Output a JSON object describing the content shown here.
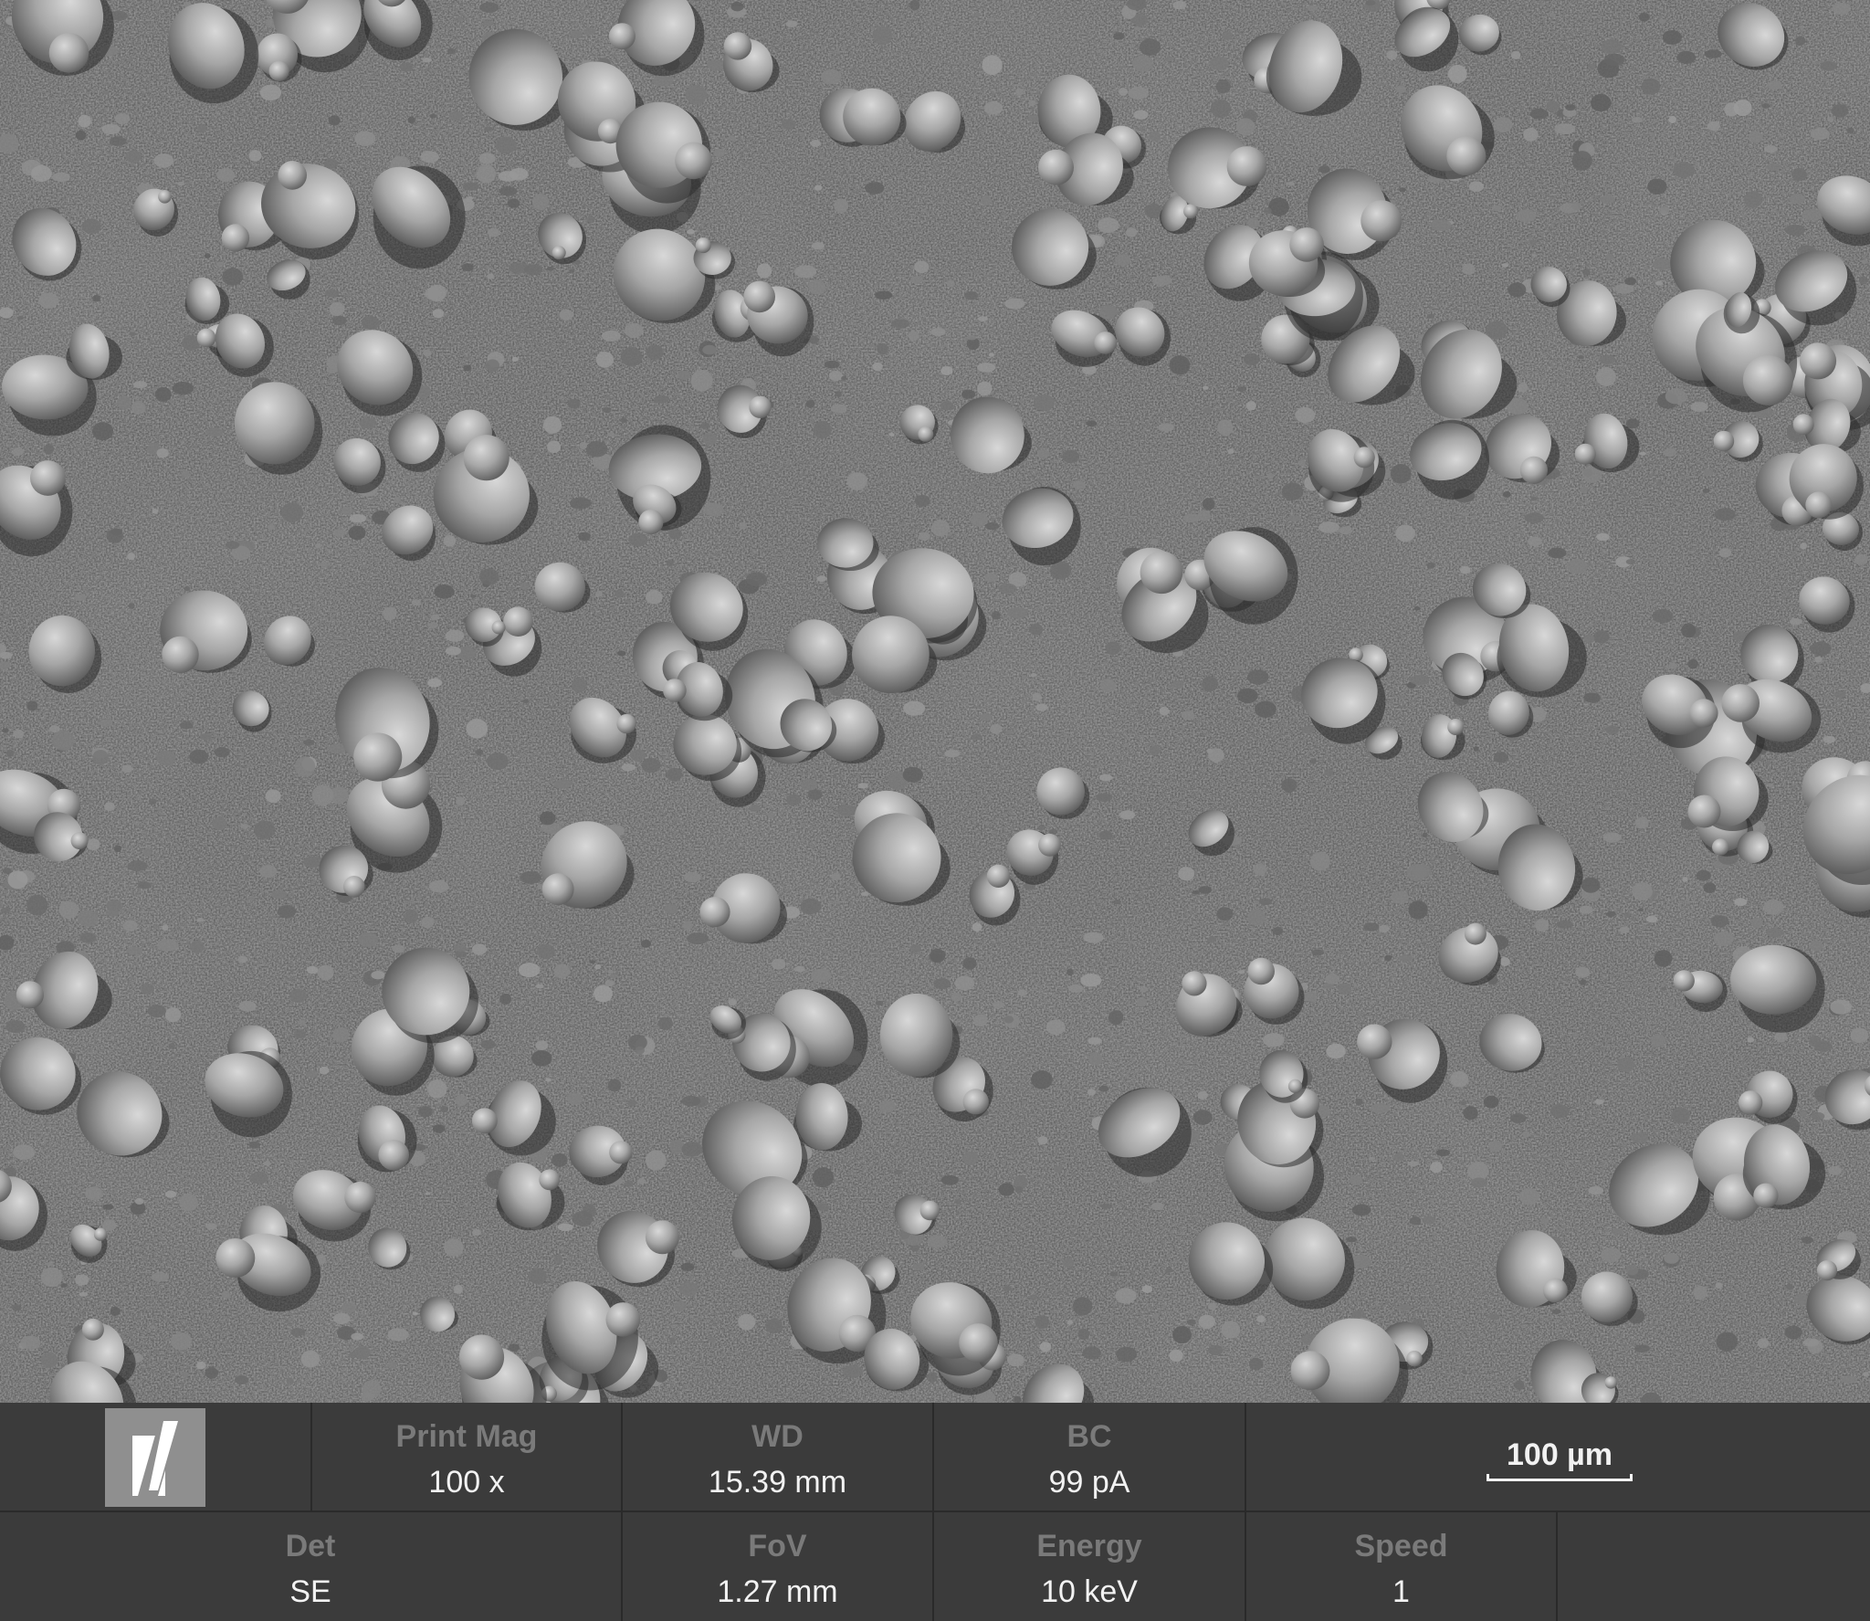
{
  "databar": {
    "print_mag": {
      "label": "Print Mag",
      "value": "100 x"
    },
    "wd": {
      "label": "WD",
      "value": "15.39 mm"
    },
    "bc": {
      "label": "BC",
      "value": "99 pA"
    },
    "det": {
      "label": "Det",
      "value": "SE"
    },
    "fov": {
      "label": "FoV",
      "value": "1.27 mm"
    },
    "energy": {
      "label": "Energy",
      "value": "10 keV"
    },
    "speed": {
      "label": "Speed",
      "value": "1"
    },
    "scale_bar": "100 µm"
  },
  "colors": {
    "bar_background": "#3b3b3b",
    "label_text": "#7a7a7a",
    "value_text": "#f2f2f2",
    "logo_background": "#8f8f8f"
  },
  "icons": [
    "instrument-logo-icon"
  ]
}
